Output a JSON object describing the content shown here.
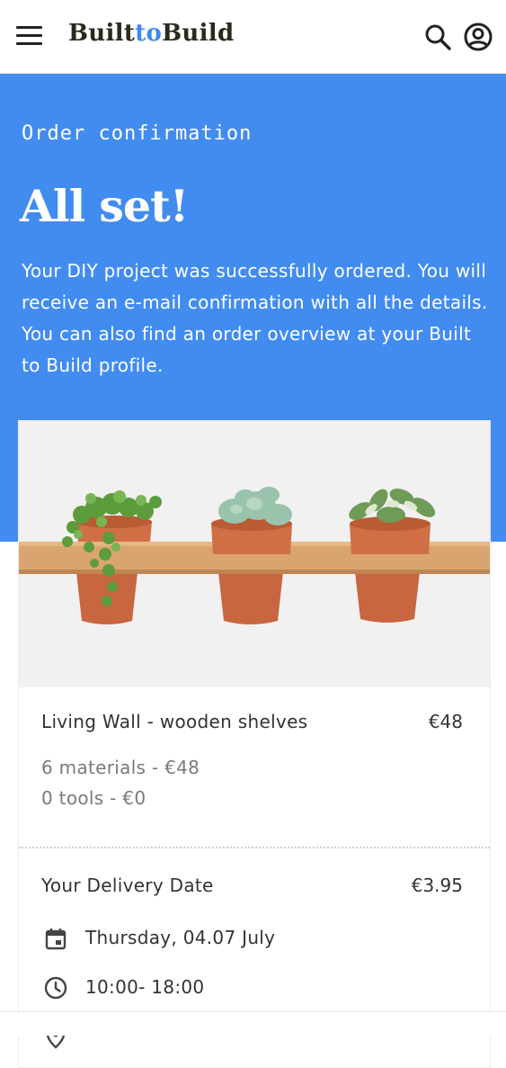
{
  "header": {
    "logo_part1": "Built",
    "logo_part2": "to",
    "logo_part3": "Build",
    "menu_icon": "hamburger-menu-icon",
    "search_icon": "search-icon",
    "account_icon": "account-circle-icon"
  },
  "hero": {
    "label": "Order confirmation",
    "title": "All set!",
    "message": "Your DIY project was successfully ordered. You will receive an e-mail confirmation with all the details. You can also find an order overview at your Built to Build profile."
  },
  "order": {
    "product_name": "Living Wall - wooden shelves",
    "product_price": "€48",
    "materials": "6 materials - €48",
    "tools": "0 tools - €0"
  },
  "delivery": {
    "title": "Your Delivery Date",
    "price": "€3.95",
    "date": "Thursday, 04.07 July",
    "time": "10:00- 18:00",
    "date_icon": "calendar-icon",
    "time_icon": "clock-icon",
    "location_icon": "location-pin-icon"
  },
  "colors": {
    "accent": "#428cf0",
    "logo_dark": "#2a2a1c",
    "logo_accent": "#3f8aee"
  }
}
